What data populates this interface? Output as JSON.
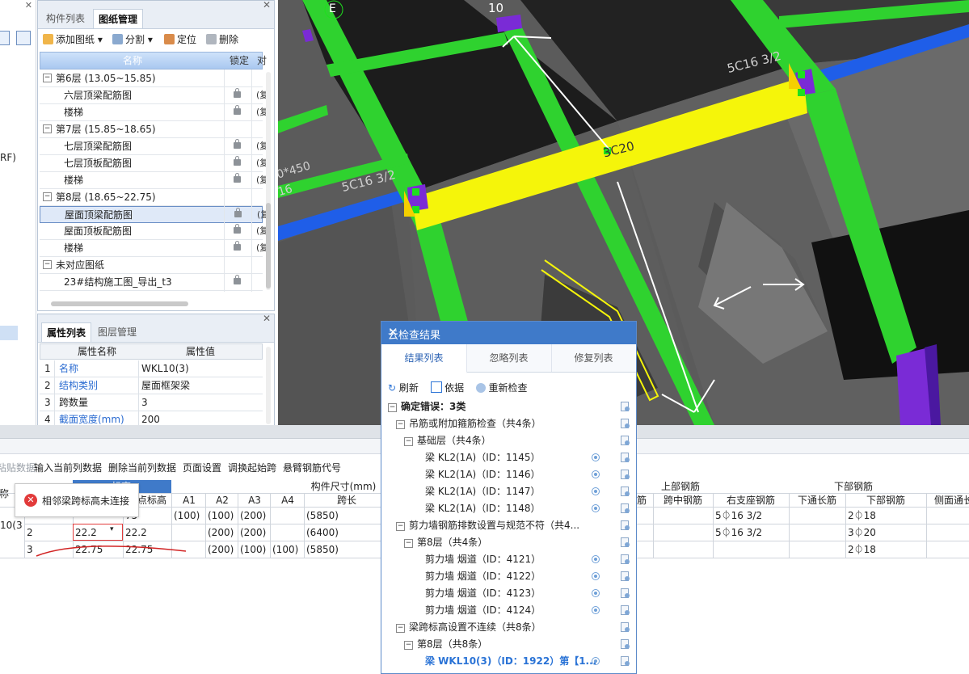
{
  "left_strip": {
    "partial_text": "RF)"
  },
  "drawing_panel": {
    "tabs": [
      "构件列表",
      "图纸管理"
    ],
    "toolbar": {
      "add": "添加图纸",
      "split": "分割",
      "locate": "定位",
      "delete": "删除"
    },
    "columns": {
      "name": "名称",
      "lock": "锁定",
      "cut": "对"
    },
    "rows": [
      {
        "level": 0,
        "label": "第6层 (13.05~15.85)",
        "toggle": "−"
      },
      {
        "level": 1,
        "label": "六层顶梁配筋图",
        "cut": "(复"
      },
      {
        "level": 1,
        "label": "楼梯",
        "cut": "(复"
      },
      {
        "level": 0,
        "label": "第7层 (15.85~18.65)",
        "toggle": "−"
      },
      {
        "level": 1,
        "label": "七层顶梁配筋图",
        "cut": "(复"
      },
      {
        "level": 1,
        "label": "七层顶板配筋图",
        "cut": "(复"
      },
      {
        "level": 1,
        "label": "楼梯",
        "cut": "(复"
      },
      {
        "level": 0,
        "label": "第8层 (18.65~22.75)",
        "toggle": "−"
      },
      {
        "level": 1,
        "label": "屋面顶梁配筋图",
        "cut": "(复",
        "selected": true
      },
      {
        "level": 1,
        "label": "屋面顶板配筋图",
        "cut": "(复"
      },
      {
        "level": 1,
        "label": "楼梯",
        "cut": "(复"
      },
      {
        "level": 0,
        "label": "未对应图纸",
        "toggle": "−"
      },
      {
        "level": 1,
        "label": "23#结构施工图_导出_t3",
        "cut": ""
      }
    ]
  },
  "prop_panel": {
    "tabs": [
      "属性列表",
      "图层管理"
    ],
    "columns": {
      "name": "属性名称",
      "value": "属性值"
    },
    "rows": [
      {
        "no": "1",
        "key": "名称",
        "value": "WKL10(3)"
      },
      {
        "no": "2",
        "key": "结构类别",
        "value": "屋面框架梁"
      },
      {
        "no": "3",
        "key": "跨数量",
        "value": "3",
        "plain": true
      },
      {
        "no": "4",
        "key": "截面宽度(mm)",
        "value": "200"
      }
    ]
  },
  "viewport": {
    "axis_labels": [
      "E",
      "10"
    ],
    "rebar_labels": [
      "5C16 3/2",
      "5C16 3/2",
      "3C20",
      "0*450",
      "16"
    ]
  },
  "bottom": {
    "toolbar": [
      "粘贴数据",
      "输入当前列数据",
      "删除当前列数据",
      "页面设置",
      "调换起始跨",
      "悬臂钢筋代号"
    ],
    "error_tip": "相邻梁跨标高未连接",
    "headers": {
      "name_partial": "称",
      "elev_group": "标高",
      "end_elev": "点标高",
      "a1": "A1",
      "a2": "A2",
      "a3": "A3",
      "a4": "A4",
      "dims_group": "构件尺寸(mm)",
      "span_len": "跨长",
      "jin_partial": "筋",
      "top_group": "上部钢筋",
      "mid_span": "跨中钢筋",
      "right_support": "右支座钢筋",
      "bottom_group": "下部钢筋",
      "bot_through": "下通长筋",
      "bot_rebar": "下部钢筋",
      "side_partial": "侧面通长"
    },
    "name_cell": "10(3",
    "rows": [
      {
        "span": "",
        "start": "",
        "end": "75",
        "a1": "(100)",
        "a2": "(100)",
        "a3": "(200)",
        "a4": "",
        "len": "(5850)",
        "right": "5⏀16 3/2",
        "bot": "2⏀18"
      },
      {
        "span": "2",
        "start": "22.2",
        "end": "22.2",
        "a1": "",
        "a2": "(200)",
        "a3": "(200)",
        "a4": "",
        "len": "(6400)",
        "right": "5⏀16 3/2",
        "bot": "3⏀20"
      },
      {
        "span": "3",
        "start": "22.75",
        "end": "22.75",
        "a1": "",
        "a2": "(200)",
        "a3": "(100)",
        "a4": "(100)",
        "len": "(5850)",
        "right": "",
        "bot": "2⏀18"
      }
    ]
  },
  "cloud_dialog": {
    "title": "云检查结果",
    "tabs": [
      "结果列表",
      "忽略列表",
      "修复列表"
    ],
    "tools": {
      "refresh": "刷新",
      "basis": "依据",
      "recheck": "重新检查"
    },
    "items": [
      {
        "indent": 0,
        "text": "确定错误：3类",
        "toggle": "−",
        "bold": true
      },
      {
        "indent": 1,
        "text": "吊筋或附加箍筋检查（共4条）",
        "toggle": "−"
      },
      {
        "indent": 2,
        "text": "基础层（共4条）",
        "toggle": "−"
      },
      {
        "indent": 3,
        "text": "梁 KL2(1A)（ID：1145）",
        "loc": true
      },
      {
        "indent": 3,
        "text": "梁 KL2(1A)（ID：1146）",
        "loc": true
      },
      {
        "indent": 3,
        "text": "梁 KL2(1A)（ID：1147）",
        "loc": true
      },
      {
        "indent": 3,
        "text": "梁 KL2(1A)（ID：1148）",
        "loc": true
      },
      {
        "indent": 1,
        "text": "剪力墙钢筋排数设置与规范不符（共4...",
        "toggle": "−"
      },
      {
        "indent": 2,
        "text": "第8层（共4条）",
        "toggle": "−"
      },
      {
        "indent": 3,
        "text": "剪力墙 烟道（ID：4121）",
        "loc": true
      },
      {
        "indent": 3,
        "text": "剪力墙 烟道（ID：4122）",
        "loc": true
      },
      {
        "indent": 3,
        "text": "剪力墙 烟道（ID：4123）",
        "loc": true
      },
      {
        "indent": 3,
        "text": "剪力墙 烟道（ID：4124）",
        "loc": true
      },
      {
        "indent": 1,
        "text": "梁跨标高设置不连续（共8条）",
        "toggle": "−"
      },
      {
        "indent": 2,
        "text": "第8层（共8条）",
        "toggle": "−"
      },
      {
        "indent": 3,
        "text": "梁 WKL10(3)（ID：1922）第【1...",
        "loc": true,
        "link": true
      }
    ]
  }
}
